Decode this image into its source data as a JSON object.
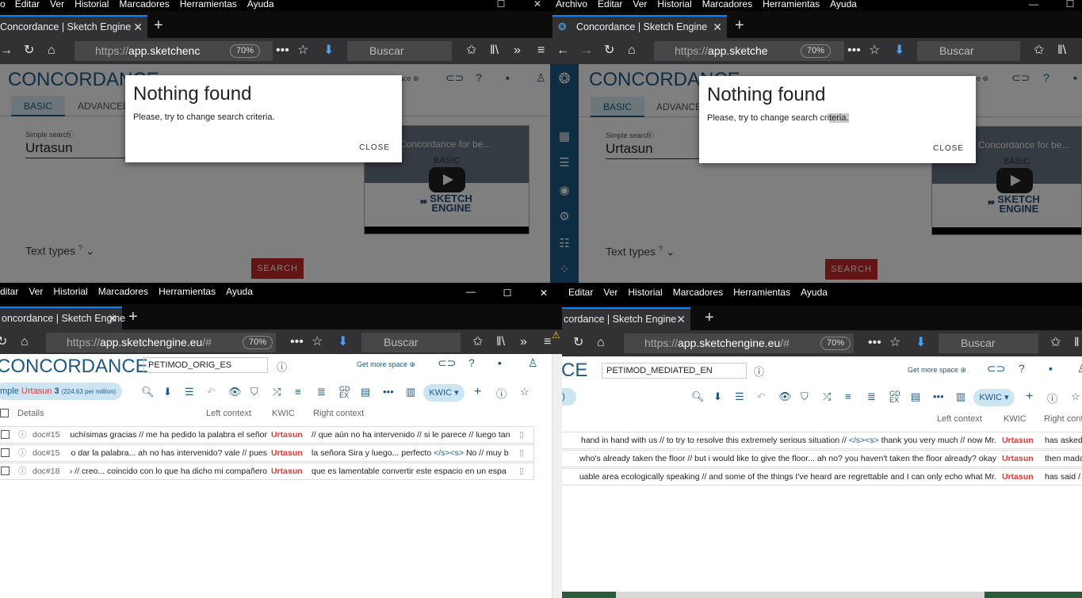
{
  "common": {
    "menu_items": [
      "Editar",
      "Ver",
      "Historial",
      "Marcadores",
      "Herramientas",
      "Ayuda"
    ],
    "tab_title": "Concordance | Sketch Engine",
    "tab_title_trunc": "dance | Sketch Engine",
    "tab_title_trunc2": "cordance | Sketch Engine",
    "tab_title_trunc3": "oncordance | Sketch Engine",
    "url_prefix": "https://",
    "url_host": "app.sketche",
    "url_host_tl": "app.sketchenc",
    "url_host_full": "app.sketchengine.eu",
    "url_suffix": "/#",
    "zoom": "70%",
    "search_placeholder": "Buscar",
    "app_title": "CONCORDANCE",
    "get_more_space": "Get more space",
    "kwic_btn": "KWIC"
  },
  "top_left": {
    "menu_first": "o",
    "tab_basic": "BASIC",
    "tab_advanced": "ADVANCED",
    "simple_search_label": "Simple search",
    "simple_search_value": "Urtasun",
    "text_types": "Text types",
    "search_button": "SEARCH",
    "video_title": "Concordance for be...",
    "video_basic": "BASIC",
    "modal_title": "Nothing found",
    "modal_text": "Please, try to change search criteria.",
    "modal_close": "CLOSE"
  },
  "top_right": {
    "menu_first": "Archivo",
    "tab_basic": "BASIC",
    "tab_advanced": "ADVANCE",
    "simple_search_label": "Simple search",
    "simple_search_value": "Urtasun",
    "text_types": "Text types",
    "search_button": "SEARCH",
    "video_title": "Concordance for be...",
    "video_basic": "BASIC",
    "modal_title": "Nothing found",
    "modal_text_a": "Please, try to change search cri",
    "modal_text_b": "teria.",
    "modal_close": "CLOSE"
  },
  "bottom_left": {
    "menu_first": "ditar",
    "corpus": "PETIMOD_ORIG_ES",
    "pill_a": "mple",
    "pill_kw": "Urtasun",
    "pill_count": "3",
    "pill_pm": "(224.63 per million)",
    "headers": {
      "details": "Details",
      "left": "Left context",
      "kwic": "KWIC",
      "right": "Right context"
    },
    "rows": [
      {
        "doc": "doc#15",
        "left": "uchísimas gracias // me ha pedido la palabra el señor",
        "kw": "Urtasun",
        "right": "// que aún no ha intervenido // si le parece // luego tan"
      },
      {
        "doc": "doc#15",
        "left": "o dar la palabra... ah no has intervenido? vale // pues",
        "kw": "Urtasun",
        "right_a": "la señora Sira y luego... perfecto ",
        "tag": "</s><s>",
        "right_b": " No // muy b"
      },
      {
        "doc": "doc#18",
        "left": "› // creo... coincido con lo que ha dicho mi compañero",
        "kw": "Urtasun",
        "right": "que es lamentable convertir este espacio en un espa"
      }
    ]
  },
  "bottom_right": {
    "corpus": "PETIMOD_MEDIATED_EN",
    "title_frag": "CE",
    "headers": {
      "left": "Left context",
      "kwic": "KWIC",
      "right": "Right cont"
    },
    "rows": [
      {
        "left_a": "hand in hand with us // to try to resolve this extremely serious situation // ",
        "tag": "</s><s>",
        "left_b": " thank you very much // now Mr.",
        "kw": "Urtasun",
        "right": "has asked"
      },
      {
        "left": "who's already taken the floor // but i would like to give the floor... ah no? you haven't taken the floor already? okay",
        "kw": "Urtasun",
        "right": "then mada"
      },
      {
        "left": "uable area ecologically speaking // and some of the things I've heard are regrettable and I can only echo what Mr.",
        "kw": "Urtasun",
        "right": "has said /"
      }
    ]
  }
}
